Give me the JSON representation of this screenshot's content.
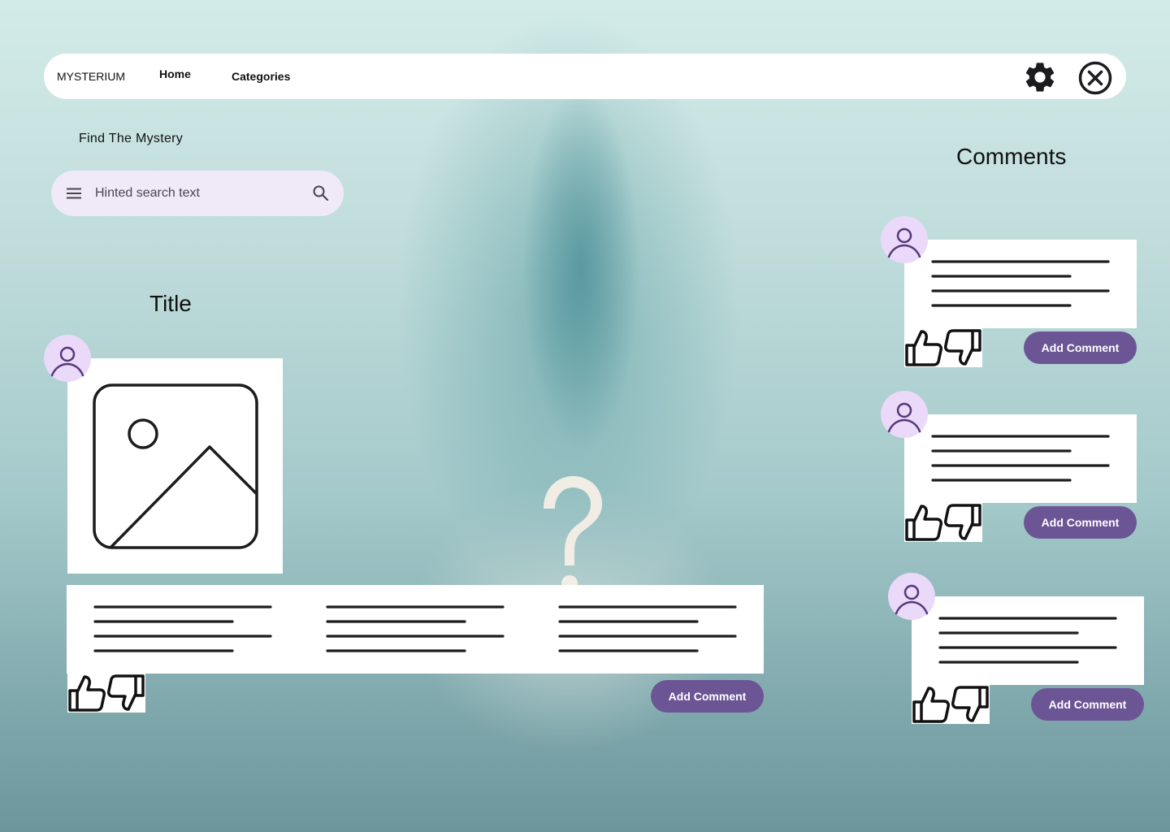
{
  "nav": {
    "brand": "MYSTERIUM",
    "links": [
      "Home",
      "Categories"
    ],
    "settings_icon": "gear-icon",
    "close_icon": "close-circle-icon"
  },
  "search": {
    "label": "Find The Mystery",
    "placeholder": "Hinted search text",
    "menu_icon": "menu-icon",
    "search_icon": "search-icon"
  },
  "post": {
    "title": "Title",
    "image_icon": "image-placeholder-icon",
    "avatar_icon": "user-icon",
    "add_comment_label": "Add Comment"
  },
  "comments": {
    "heading": "Comments",
    "items": [
      {
        "add_comment_label": "Add Comment"
      },
      {
        "add_comment_label": "Add Comment"
      },
      {
        "add_comment_label": "Add Comment"
      }
    ]
  },
  "colors": {
    "accent": "#6c5595",
    "avatar_bg": "#ead9f8",
    "search_bg": "#f0e9f7"
  }
}
